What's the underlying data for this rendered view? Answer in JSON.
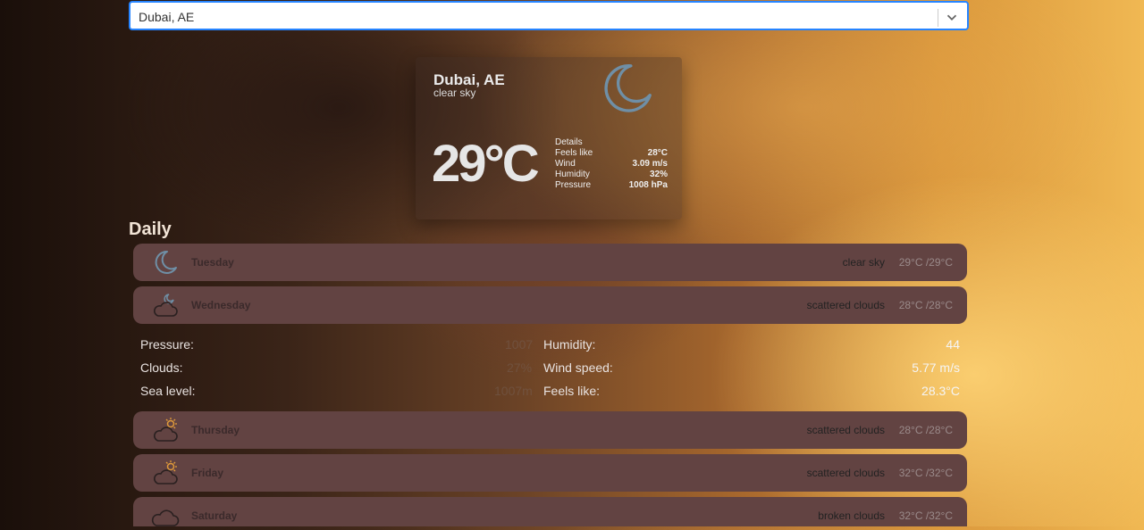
{
  "search": {
    "value": "Dubai, AE"
  },
  "current": {
    "city": "Dubai, AE",
    "description": "clear sky",
    "icon": "moon-icon",
    "temp": "29°C",
    "details_label": "Details",
    "details": [
      {
        "label": "Feels like",
        "value": "28°C"
      },
      {
        "label": "Wind",
        "value": "3.09 m/s"
      },
      {
        "label": "Humidity",
        "value": "32%"
      },
      {
        "label": "Pressure",
        "value": "1008 hPa"
      }
    ]
  },
  "daily": {
    "title": "Daily",
    "days": [
      {
        "day": "Tuesday",
        "desc": "clear sky",
        "temp": "29°C /29°C",
        "icon": "moon-icon"
      },
      {
        "day": "Wednesday",
        "desc": "scattered clouds",
        "temp": "28°C /28°C",
        "icon": "cloud-moon-icon"
      },
      {
        "day": "Thursday",
        "desc": "scattered clouds",
        "temp": "28°C /28°C",
        "icon": "cloud-sun-icon"
      },
      {
        "day": "Friday",
        "desc": "scattered clouds",
        "temp": "32°C /32°C",
        "icon": "cloud-sun-icon"
      },
      {
        "day": "Saturday",
        "desc": "broken clouds",
        "temp": "32°C /32°C",
        "icon": "cloud-icon"
      }
    ],
    "expanded": {
      "pressure_label": "Pressure:",
      "pressure_value": "1007",
      "clouds_label": "Clouds:",
      "clouds_value": "27%",
      "sea_label": "Sea level:",
      "sea_value": "1007m",
      "humidity_label": "Humidity:",
      "humidity_value": "44",
      "wind_label": "Wind speed:",
      "wind_value": "5.77 m/s",
      "feels_label": "Feels like:",
      "feels_value": "28.3°C"
    }
  }
}
